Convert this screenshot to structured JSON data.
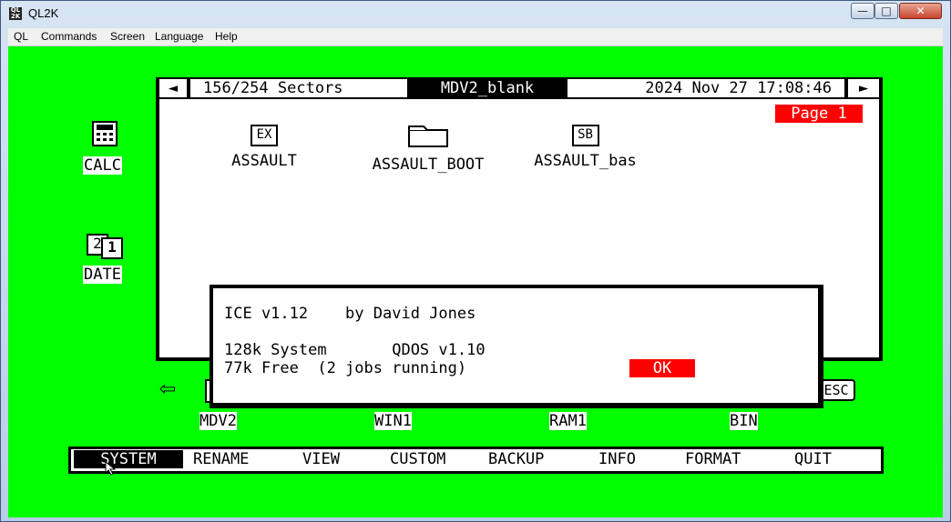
{
  "window": {
    "title": "QL2K",
    "app_icon": "QL 2K",
    "min": "—",
    "max": "□",
    "close": "✕"
  },
  "menubar": [
    "QL",
    "Commands",
    "Screen",
    "Language",
    "Help"
  ],
  "desktop": {
    "calc": {
      "label": "CALC"
    },
    "date": {
      "label": "DATE",
      "icon_text_a": "2",
      "icon_text_b": "1"
    }
  },
  "file_manager": {
    "sectors": "156/254 Sectors",
    "drive_name": "MDV2_blank",
    "datetime": "2024 Nov 27 17:08:46",
    "left_arrow": "◄",
    "right_arrow": "►",
    "page": "Page 1",
    "files": [
      {
        "name": "ASSAULT",
        "icon_text": "EX",
        "kind": "executable"
      },
      {
        "name": "ASSAULT_BOOT",
        "icon_text": "",
        "kind": "folder"
      },
      {
        "name": "ASSAULT_bas",
        "icon_text": "SB",
        "kind": "basic"
      }
    ]
  },
  "dialog": {
    "line1": "ICE v1.12    by David Jones",
    "line2": "128k System       QDOS v1.10",
    "line3": "77k Free  (2 jobs running)",
    "ok": "OK"
  },
  "devices": {
    "back_arrow": "⇦",
    "esc": "ESC",
    "items": [
      "MDV2",
      "WIN1",
      "RAM1",
      "BIN"
    ]
  },
  "menu": [
    "SYSTEM",
    "RENAME",
    "VIEW",
    "CUSTOM",
    "BACKUP",
    "INFO",
    "FORMAT",
    "QUIT"
  ]
}
